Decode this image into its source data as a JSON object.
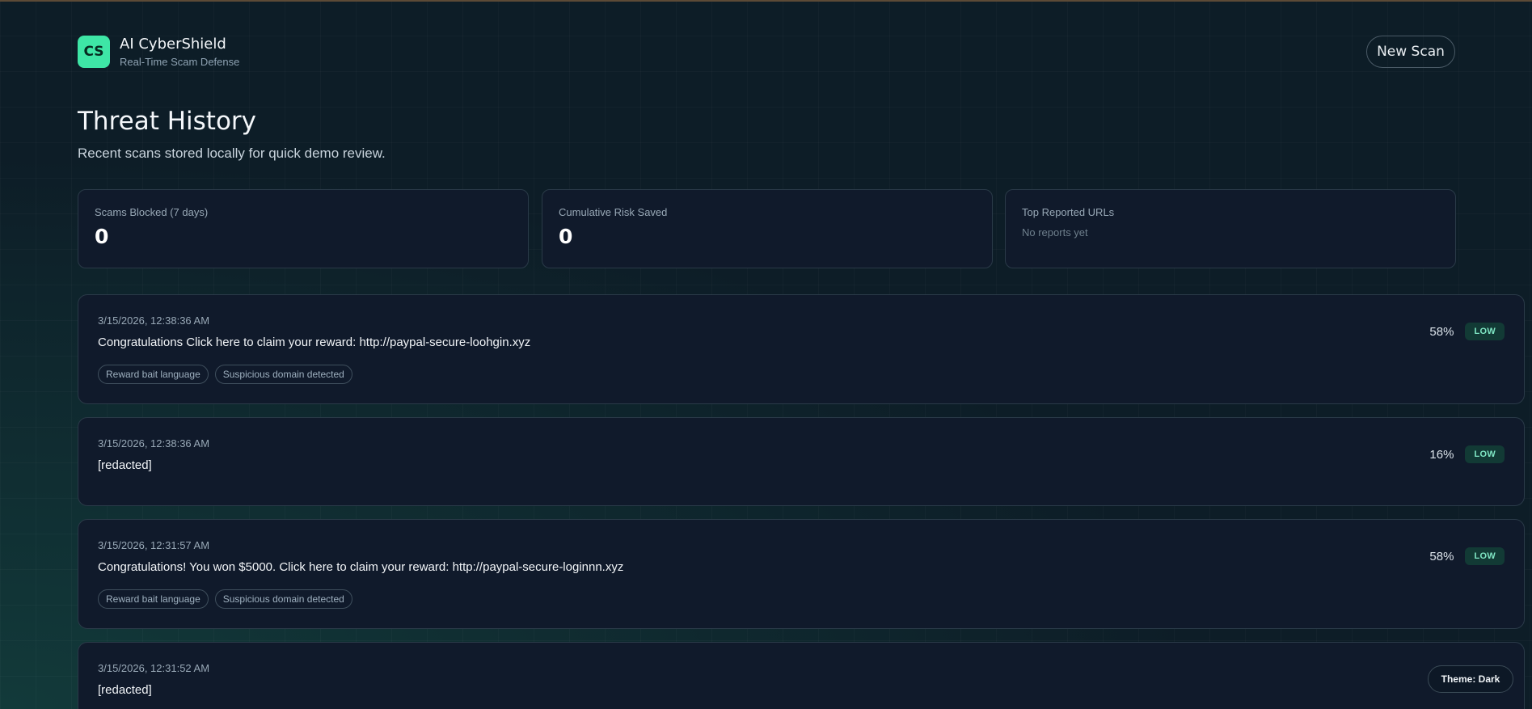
{
  "brand": {
    "logo": "CS",
    "name": "AI CyberShield",
    "tagline": "Real-Time Scam Defense"
  },
  "header": {
    "new_scan_label": "New Scan"
  },
  "page": {
    "title": "Threat History",
    "subtitle": "Recent scans stored locally for quick demo review."
  },
  "stats": {
    "scams_blocked": {
      "label": "Scams Blocked (7 days)",
      "value": "0"
    },
    "risk_saved": {
      "label": "Cumulative Risk Saved",
      "value": "0"
    },
    "top_urls": {
      "label": "Top Reported URLs",
      "empty_text": "No reports yet"
    }
  },
  "scans": [
    {
      "timestamp": "3/15/2026, 12:38:36 AM",
      "message": "Congratulations Click here to claim your reward: http://paypal-secure-loohgin.xyz",
      "score": "58%",
      "level": "LOW",
      "tags": [
        "Reward bait language",
        "Suspicious domain detected"
      ]
    },
    {
      "timestamp": "3/15/2026, 12:38:36 AM",
      "message": "[redacted]",
      "score": "16%",
      "level": "LOW",
      "tags": []
    },
    {
      "timestamp": "3/15/2026, 12:31:57 AM",
      "message": "Congratulations! You won $5000. Click here to claim your reward: http://paypal-secure-loginnn.xyz",
      "score": "58%",
      "level": "LOW",
      "tags": [
        "Reward bait language",
        "Suspicious domain detected"
      ]
    },
    {
      "timestamp": "3/15/2026, 12:31:52 AM",
      "message": "[redacted]",
      "score": "",
      "level": "",
      "tags": []
    }
  ],
  "theme_toggle": {
    "label": "Theme: Dark"
  },
  "colors": {
    "accent": "#3ee6a6",
    "background": "#0d1d27",
    "card": "#101a2b",
    "badge_low_bg": "#123a35",
    "badge_low_text": "#7fe6c4"
  }
}
